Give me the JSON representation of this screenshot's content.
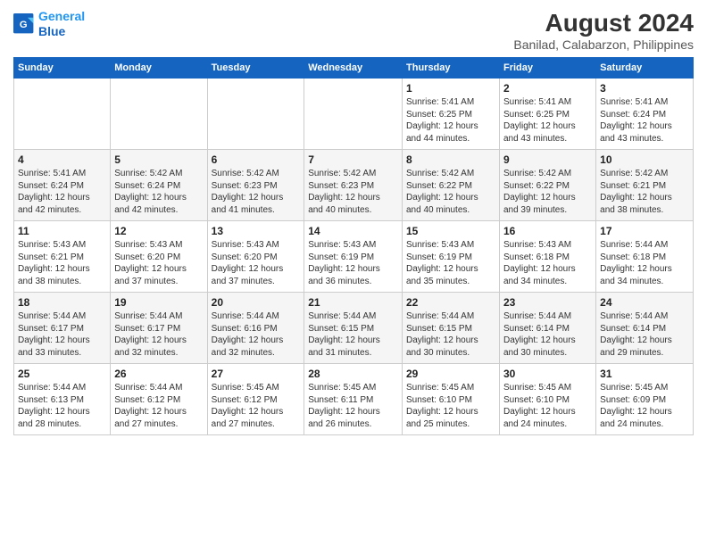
{
  "header": {
    "logo_line1": "General",
    "logo_line2": "Blue",
    "month_year": "August 2024",
    "location": "Banilad, Calabarzon, Philippines"
  },
  "weekdays": [
    "Sunday",
    "Monday",
    "Tuesday",
    "Wednesday",
    "Thursday",
    "Friday",
    "Saturday"
  ],
  "weeks": [
    [
      {
        "day": "",
        "info": ""
      },
      {
        "day": "",
        "info": ""
      },
      {
        "day": "",
        "info": ""
      },
      {
        "day": "",
        "info": ""
      },
      {
        "day": "1",
        "info": "Sunrise: 5:41 AM\nSunset: 6:25 PM\nDaylight: 12 hours\nand 44 minutes."
      },
      {
        "day": "2",
        "info": "Sunrise: 5:41 AM\nSunset: 6:25 PM\nDaylight: 12 hours\nand 43 minutes."
      },
      {
        "day": "3",
        "info": "Sunrise: 5:41 AM\nSunset: 6:24 PM\nDaylight: 12 hours\nand 43 minutes."
      }
    ],
    [
      {
        "day": "4",
        "info": "Sunrise: 5:41 AM\nSunset: 6:24 PM\nDaylight: 12 hours\nand 42 minutes."
      },
      {
        "day": "5",
        "info": "Sunrise: 5:42 AM\nSunset: 6:24 PM\nDaylight: 12 hours\nand 42 minutes."
      },
      {
        "day": "6",
        "info": "Sunrise: 5:42 AM\nSunset: 6:23 PM\nDaylight: 12 hours\nand 41 minutes."
      },
      {
        "day": "7",
        "info": "Sunrise: 5:42 AM\nSunset: 6:23 PM\nDaylight: 12 hours\nand 40 minutes."
      },
      {
        "day": "8",
        "info": "Sunrise: 5:42 AM\nSunset: 6:22 PM\nDaylight: 12 hours\nand 40 minutes."
      },
      {
        "day": "9",
        "info": "Sunrise: 5:42 AM\nSunset: 6:22 PM\nDaylight: 12 hours\nand 39 minutes."
      },
      {
        "day": "10",
        "info": "Sunrise: 5:42 AM\nSunset: 6:21 PM\nDaylight: 12 hours\nand 38 minutes."
      }
    ],
    [
      {
        "day": "11",
        "info": "Sunrise: 5:43 AM\nSunset: 6:21 PM\nDaylight: 12 hours\nand 38 minutes."
      },
      {
        "day": "12",
        "info": "Sunrise: 5:43 AM\nSunset: 6:20 PM\nDaylight: 12 hours\nand 37 minutes."
      },
      {
        "day": "13",
        "info": "Sunrise: 5:43 AM\nSunset: 6:20 PM\nDaylight: 12 hours\nand 37 minutes."
      },
      {
        "day": "14",
        "info": "Sunrise: 5:43 AM\nSunset: 6:19 PM\nDaylight: 12 hours\nand 36 minutes."
      },
      {
        "day": "15",
        "info": "Sunrise: 5:43 AM\nSunset: 6:19 PM\nDaylight: 12 hours\nand 35 minutes."
      },
      {
        "day": "16",
        "info": "Sunrise: 5:43 AM\nSunset: 6:18 PM\nDaylight: 12 hours\nand 34 minutes."
      },
      {
        "day": "17",
        "info": "Sunrise: 5:44 AM\nSunset: 6:18 PM\nDaylight: 12 hours\nand 34 minutes."
      }
    ],
    [
      {
        "day": "18",
        "info": "Sunrise: 5:44 AM\nSunset: 6:17 PM\nDaylight: 12 hours\nand 33 minutes."
      },
      {
        "day": "19",
        "info": "Sunrise: 5:44 AM\nSunset: 6:17 PM\nDaylight: 12 hours\nand 32 minutes."
      },
      {
        "day": "20",
        "info": "Sunrise: 5:44 AM\nSunset: 6:16 PM\nDaylight: 12 hours\nand 32 minutes."
      },
      {
        "day": "21",
        "info": "Sunrise: 5:44 AM\nSunset: 6:15 PM\nDaylight: 12 hours\nand 31 minutes."
      },
      {
        "day": "22",
        "info": "Sunrise: 5:44 AM\nSunset: 6:15 PM\nDaylight: 12 hours\nand 30 minutes."
      },
      {
        "day": "23",
        "info": "Sunrise: 5:44 AM\nSunset: 6:14 PM\nDaylight: 12 hours\nand 30 minutes."
      },
      {
        "day": "24",
        "info": "Sunrise: 5:44 AM\nSunset: 6:14 PM\nDaylight: 12 hours\nand 29 minutes."
      }
    ],
    [
      {
        "day": "25",
        "info": "Sunrise: 5:44 AM\nSunset: 6:13 PM\nDaylight: 12 hours\nand 28 minutes."
      },
      {
        "day": "26",
        "info": "Sunrise: 5:44 AM\nSunset: 6:12 PM\nDaylight: 12 hours\nand 27 minutes."
      },
      {
        "day": "27",
        "info": "Sunrise: 5:45 AM\nSunset: 6:12 PM\nDaylight: 12 hours\nand 27 minutes."
      },
      {
        "day": "28",
        "info": "Sunrise: 5:45 AM\nSunset: 6:11 PM\nDaylight: 12 hours\nand 26 minutes."
      },
      {
        "day": "29",
        "info": "Sunrise: 5:45 AM\nSunset: 6:10 PM\nDaylight: 12 hours\nand 25 minutes."
      },
      {
        "day": "30",
        "info": "Sunrise: 5:45 AM\nSunset: 6:10 PM\nDaylight: 12 hours\nand 24 minutes."
      },
      {
        "day": "31",
        "info": "Sunrise: 5:45 AM\nSunset: 6:09 PM\nDaylight: 12 hours\nand 24 minutes."
      }
    ]
  ]
}
